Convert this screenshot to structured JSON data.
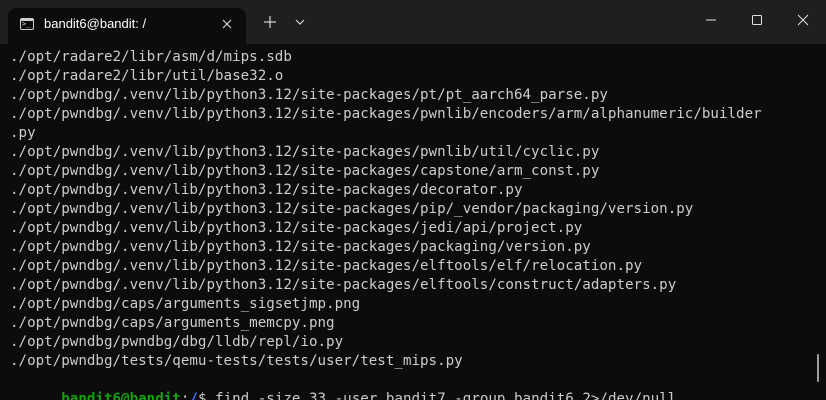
{
  "tab": {
    "title": "bandit6@bandit: /",
    "icon": "terminal-icon",
    "prompt_glyph": ">_"
  },
  "titlebar": {
    "new_tab_icon": "plus-icon",
    "dropdown_icon": "chevron-down-icon",
    "minimize_icon": "minimize-icon",
    "maximize_icon": "maximize-icon",
    "close_icon": "close-icon"
  },
  "terminal": {
    "lines": [
      "./opt/radare2/libr/asm/d/mips.sdb",
      "./opt/radare2/libr/util/base32.o",
      "./opt/pwndbg/.venv/lib/python3.12/site-packages/pt/pt_aarch64_parse.py",
      "./opt/pwndbg/.venv/lib/python3.12/site-packages/pwnlib/encoders/arm/alphanumeric/builder",
      ".py",
      "./opt/pwndbg/.venv/lib/python3.12/site-packages/pwnlib/util/cyclic.py",
      "./opt/pwndbg/.venv/lib/python3.12/site-packages/capstone/arm_const.py",
      "./opt/pwndbg/.venv/lib/python3.12/site-packages/decorator.py",
      "./opt/pwndbg/.venv/lib/python3.12/site-packages/pip/_vendor/packaging/version.py",
      "./opt/pwndbg/.venv/lib/python3.12/site-packages/jedi/api/project.py",
      "./opt/pwndbg/.venv/lib/python3.12/site-packages/packaging/version.py",
      "./opt/pwndbg/.venv/lib/python3.12/site-packages/elftools/elf/relocation.py",
      "./opt/pwndbg/.venv/lib/python3.12/site-packages/elftools/construct/adapters.py",
      "./opt/pwndbg/caps/arguments_sigsetjmp.png",
      "./opt/pwndbg/caps/arguments_memcpy.png",
      "./opt/pwndbg/pwndbg/dbg/lldb/repl/io.py",
      "./opt/pwndbg/tests/qemu-tests/tests/user/test_mips.py"
    ],
    "prompt": {
      "user": "bandit6@bandit",
      "sep": ":",
      "path": "/",
      "symbol": "$ ",
      "command": "find -size 33 -user bandit7 -group bandit6 2>/dev/null"
    },
    "colors": {
      "prompt_user": "#13a10e",
      "prompt_path": "#3b78ff",
      "text": "#cccccc",
      "background": "#0c0c0c"
    }
  }
}
